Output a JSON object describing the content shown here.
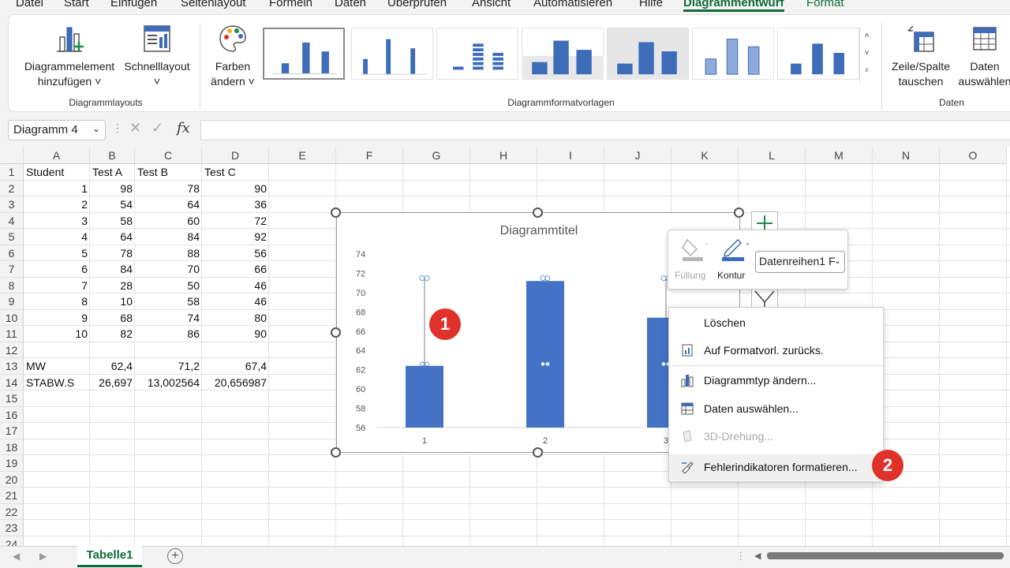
{
  "menu": {
    "tabs": [
      "Datei",
      "Start",
      "Einfügen",
      "Seitenlayout",
      "Formeln",
      "Daten",
      "Überprüfen",
      "Ansicht",
      "Automatisieren",
      "Hilfe",
      "Diagrammentwurf",
      "Format"
    ],
    "active_tab": "Diagrammentwurf"
  },
  "ribbon": {
    "add_element_line1": "Diagrammelement",
    "add_element_line2": "hinzufügen ˅",
    "quick_layout_line1": "Schnelllayout",
    "quick_layout_line2": "˅",
    "colors_line1": "Farben",
    "colors_line2": "ändern ˅",
    "switch_line1": "Zeile/Spalte",
    "switch_line2": "tauschen",
    "select_data_line1": "Daten",
    "select_data_line2": "auswählen",
    "group_layouts": "Diagrammlayouts",
    "group_styles": "Diagrammformatvorlagen",
    "group_data": "Daten"
  },
  "formula_bar": {
    "name_box": "Diagramm 4",
    "fx": "fx",
    "value": ""
  },
  "grid": {
    "columns": [
      "A",
      "B",
      "C",
      "D",
      "E",
      "F",
      "G",
      "H",
      "I",
      "J",
      "K",
      "L",
      "M",
      "N",
      "O"
    ],
    "rows": [
      "1",
      "2",
      "3",
      "4",
      "5",
      "6",
      "7",
      "8",
      "9",
      "10",
      "11",
      "12",
      "13",
      "14",
      "15",
      "16",
      "17",
      "18",
      "19",
      "20",
      "21",
      "22",
      "23",
      "24"
    ],
    "header": [
      "Student",
      "Test A",
      "Test B",
      "Test C"
    ],
    "data_rows": [
      [
        "1",
        "98",
        "78",
        "90"
      ],
      [
        "2",
        "54",
        "64",
        "36"
      ],
      [
        "3",
        "58",
        "60",
        "72"
      ],
      [
        "4",
        "64",
        "84",
        "92"
      ],
      [
        "5",
        "78",
        "88",
        "56"
      ],
      [
        "6",
        "84",
        "70",
        "66"
      ],
      [
        "7",
        "28",
        "50",
        "46"
      ],
      [
        "8",
        "10",
        "58",
        "46"
      ],
      [
        "9",
        "68",
        "74",
        "80"
      ],
      [
        "10",
        "82",
        "86",
        "90"
      ]
    ],
    "mw": [
      "MW",
      "62,4",
      "71,2",
      "67,4"
    ],
    "stabw": [
      "STABW.S",
      "26,697",
      "13,002564",
      "20,656987"
    ]
  },
  "chart": {
    "title": "Diagrammtitel",
    "bar_color": "#4472c4"
  },
  "chart_data": {
    "type": "bar",
    "title": "Diagrammtitel",
    "categories": [
      "1",
      "2",
      "3"
    ],
    "values": [
      62.4,
      71.2,
      67.4
    ],
    "error_bar_top": [
      71.5,
      71.5,
      71.5
    ],
    "error_bar_marker_low": [
      62.6,
      62.6,
      62.6
    ],
    "ylim": [
      56,
      74
    ],
    "yticks": [
      "56",
      "58",
      "60",
      "62",
      "64",
      "66",
      "68",
      "70",
      "72",
      "74"
    ],
    "grid": false,
    "legend": "none"
  },
  "mini_toolbar": {
    "fill_label": "Füllung",
    "outline_label": "Kontur",
    "series_value": "Datenreihen1 F"
  },
  "context_menu": {
    "items": [
      {
        "label": "Löschen",
        "icon": "none",
        "disabled": false
      },
      {
        "label": "Auf Formatvorl. zurücks.",
        "icon": "reset-style-icon",
        "disabled": false
      },
      {
        "label": "Diagrammtyp ändern...",
        "icon": "chart-type-icon",
        "disabled": false
      },
      {
        "label": "Daten auswählen...",
        "icon": "select-data-icon",
        "disabled": false
      },
      {
        "label": "3D-Drehung...",
        "icon": "rotate-3d-icon",
        "disabled": true
      },
      {
        "label": "Fehlerindikatoren formatieren...",
        "icon": "format-error-bars-icon",
        "disabled": false
      }
    ]
  },
  "callouts": [
    "1",
    "2"
  ],
  "sheets": {
    "active": "Tabelle1",
    "add": "+"
  }
}
